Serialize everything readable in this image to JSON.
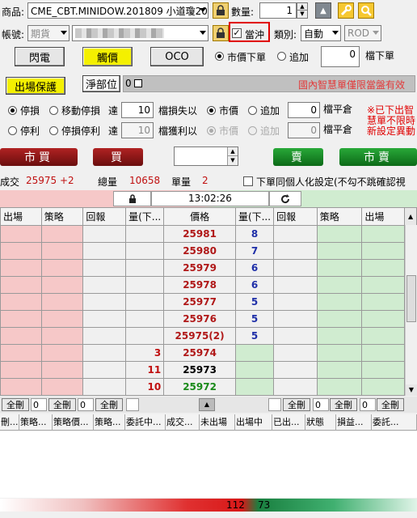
{
  "top": {
    "product_label": "商品:",
    "product_value": "CME_CBT.MINIDOW.201809 小道瓊20",
    "qty_label": "數量:",
    "qty_value": "1",
    "account_label": "帳號:",
    "account_type": "期貨",
    "daytrade_label": "當沖",
    "category_label": "類別:",
    "category_value": "自動",
    "rod_value": "ROD",
    "flash_btn": "閃電",
    "touch_btn": "觸價",
    "oco_btn": "OCO",
    "market_order_label": "市價下單",
    "chase_label": "追加",
    "tick_value": "0",
    "tick_label": "檔下單",
    "exit_protect_btn": "出場保護",
    "net_position_btn": "淨部位",
    "net_position_value": "0",
    "notice_text": "國內智慧單僅限當盤有效"
  },
  "stops": {
    "row1": {
      "stoploss": "停損",
      "trailing": "移動停損",
      "reach": "達",
      "val": "10",
      "tick_loss": "檔損失以",
      "market": "市價",
      "chase": "追加",
      "chase_val": "0",
      "close": "檔平倉"
    },
    "row2": {
      "stopprofit": "停利",
      "stoploss_profit": "停損停利",
      "reach": "達",
      "val": "10",
      "tick_gain": "檔獲利以",
      "market": "市價",
      "chase": "追加",
      "chase_val": "0",
      "close": "檔平倉"
    },
    "warn": [
      "※已下出智",
      "慧單不限時",
      "新設定異動"
    ]
  },
  "trade": {
    "market_buy": "市買",
    "buy": "買",
    "sell": "賣",
    "market_sell": "市賣"
  },
  "stats": {
    "deal_label": "成交",
    "deal_value": "25975 +2",
    "total_label": "總量",
    "total_value": "10658",
    "single_label": "單量",
    "single_value": "2",
    "same_setting_label": "下單同個人化設定(不勾不跳確認視"
  },
  "time": "13:02:26",
  "book": {
    "headers": [
      "出場",
      "策略",
      "回報",
      "量(下...",
      "價格",
      "量(下...",
      "回報",
      "策略",
      "出場"
    ],
    "rows": [
      {
        "price": "25981",
        "bidq": "",
        "askq": "8",
        "price_color": "#b01818",
        "ask_side": true
      },
      {
        "price": "25980",
        "bidq": "",
        "askq": "7",
        "price_color": "#b01818",
        "ask_side": true
      },
      {
        "price": "25979",
        "bidq": "",
        "askq": "6",
        "price_color": "#b01818",
        "ask_side": true
      },
      {
        "price": "25978",
        "bidq": "",
        "askq": "6",
        "price_color": "#b01818",
        "ask_side": true
      },
      {
        "price": "25977",
        "bidq": "",
        "askq": "5",
        "price_color": "#b01818",
        "ask_side": true
      },
      {
        "price": "25976",
        "bidq": "",
        "askq": "5",
        "price_color": "#b01818",
        "ask_side": true
      },
      {
        "price": "25975(2)",
        "bidq": "",
        "askq": "5",
        "price_color": "#b01818",
        "ask_side": true
      },
      {
        "price": "25974",
        "bidq": "3",
        "askq": "",
        "price_color": "#b01818",
        "ask_side": false
      },
      {
        "price": "25973",
        "bidq": "11",
        "askq": "",
        "price_color": "#000000",
        "ask_side": false
      },
      {
        "price": "25972",
        "bidq": "10",
        "askq": "",
        "price_color": "#1a8a1a",
        "ask_side": false
      }
    ]
  },
  "bottom_bar": {
    "left": [
      {
        "btn": "全刪",
        "val": "0"
      },
      {
        "btn": "全刪",
        "val": "0"
      },
      {
        "btn": "全刪",
        "val": ""
      }
    ],
    "right": [
      {
        "btn": "全刪",
        "val": "0"
      },
      {
        "btn": "全刪",
        "val": "0"
      },
      {
        "btn": "全刪",
        "val": ""
      }
    ]
  },
  "orders_headers": [
    "刪...",
    "策略...",
    "策略價...",
    "策略...",
    "委託中...",
    "成交...",
    "未出場",
    "出場中",
    "已出...",
    "狀態",
    "損益...",
    "委託..."
  ],
  "volume_bar": {
    "sell": "112",
    "buy": "73"
  },
  "colors": {
    "bid_bg": "#f6c8c8",
    "ask_bg": "#d0ecd0",
    "accent_red": "#cc0000"
  }
}
